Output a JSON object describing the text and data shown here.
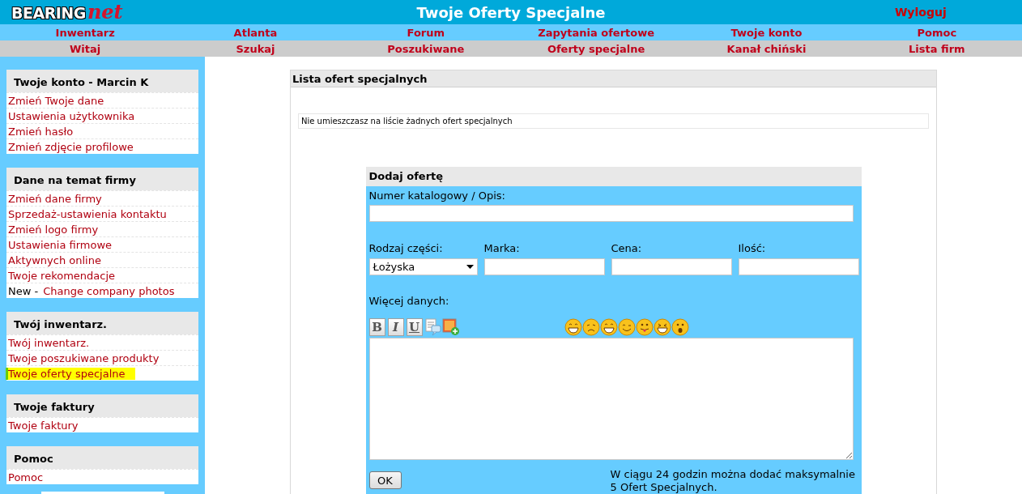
{
  "header": {
    "logo": {
      "word": "BEARING",
      "script": "net"
    },
    "title": "Twoje Oferty Specjalne",
    "logout": "Wyloguj"
  },
  "nav_rows": [
    [
      "Inwentarz",
      "Atlanta",
      "Forum",
      "Zapytania ofertowe",
      "Twoje konto",
      "Pomoc"
    ],
    [
      "Witaj",
      "Szukaj",
      "Poszukiwane",
      "Oferty specjalne",
      "Kanał chiński",
      "Lista firm"
    ]
  ],
  "sidebar": {
    "sections": [
      {
        "title": "Twoje konto - Marcin K",
        "items": [
          {
            "label": "Zmień Twoje dane",
            "selected": false
          },
          {
            "label": "Ustawienia użytkownika",
            "selected": false
          },
          {
            "label": "Zmień hasło",
            "selected": false
          },
          {
            "label": "Zmień zdjęcie profilowe",
            "selected": false
          }
        ]
      },
      {
        "title": "Dane na temat firmy",
        "items": [
          {
            "label": "Zmień dane firmy",
            "selected": false
          },
          {
            "label": "Sprzedaż-ustawienia kontaktu",
            "selected": false
          },
          {
            "label": "Zmień logo firmy",
            "selected": false
          },
          {
            "label": "Ustawienia firmowe",
            "selected": false
          },
          {
            "label": "Aktywnych online",
            "selected": false
          },
          {
            "label": "Twoje rekomendacje",
            "selected": false
          },
          {
            "prefix": "New -",
            "label": "Change company photos",
            "selected": false
          }
        ]
      },
      {
        "title": "Twój inwentarz.",
        "items": [
          {
            "label": "Twój inwentarz.",
            "selected": false
          },
          {
            "label": "Twoje poszukiwane produkty",
            "selected": false
          },
          {
            "label": "Twoje oferty specjalne",
            "selected": true
          }
        ]
      },
      {
        "title": "Twoje faktury",
        "items": [
          {
            "label": "Twoje faktury",
            "selected": false
          }
        ]
      },
      {
        "title": "Pomoc",
        "items": [
          {
            "label": "Pomoc",
            "selected": false
          }
        ]
      }
    ]
  },
  "offers_list": {
    "title": "Lista ofert specjalnych",
    "message": "Nie umieszczasz na liście żadnych ofert specjalnych"
  },
  "add_offer": {
    "title": "Dodaj ofertę",
    "description_label": "Numer katalogowy / Opis:",
    "fields": [
      {
        "label": "Rodzaj części:",
        "kind": "select",
        "value": "Łożyska"
      },
      {
        "label": "Marka:",
        "kind": "text"
      },
      {
        "label": "Cena:",
        "kind": "text"
      },
      {
        "label": "Ilość:",
        "kind": "text"
      }
    ],
    "more_label": "Więcej danych:",
    "format_buttons": [
      "B",
      "I",
      "U"
    ],
    "submit": "OK",
    "note": "W ciągu 24 godzin można dodać maksymalnie 5 Ofert Specjalnych."
  }
}
